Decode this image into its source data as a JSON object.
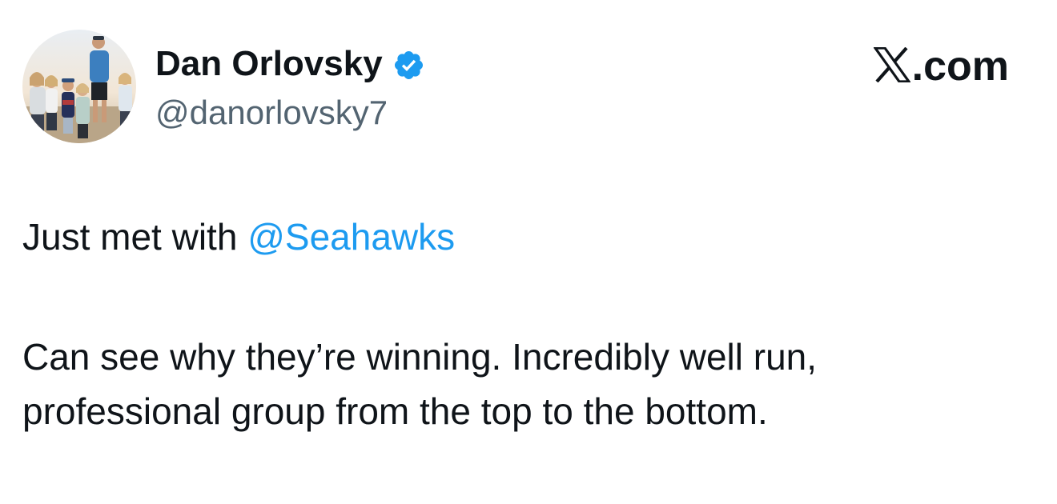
{
  "author": {
    "display_name": "Dan Orlovsky",
    "handle": "@danorlovsky7",
    "verified": true,
    "avatar_icon": "family-photo-avatar",
    "verified_icon": "verified-badge-icon",
    "verified_color": "#1d9bf0"
  },
  "brand": {
    "logo_icon": "x-logo-icon",
    "suffix": ".com"
  },
  "tweet": {
    "line1_prefix": "Just met with ",
    "mention": "@Seahawks",
    "line2": "Can see why they’re winning. Incredibly well run,",
    "line3": "professional group from the top to the bottom."
  },
  "colors": {
    "text": "#0f1419",
    "secondary_text": "#536471",
    "link": "#1d9bf0",
    "background": "#ffffff"
  }
}
